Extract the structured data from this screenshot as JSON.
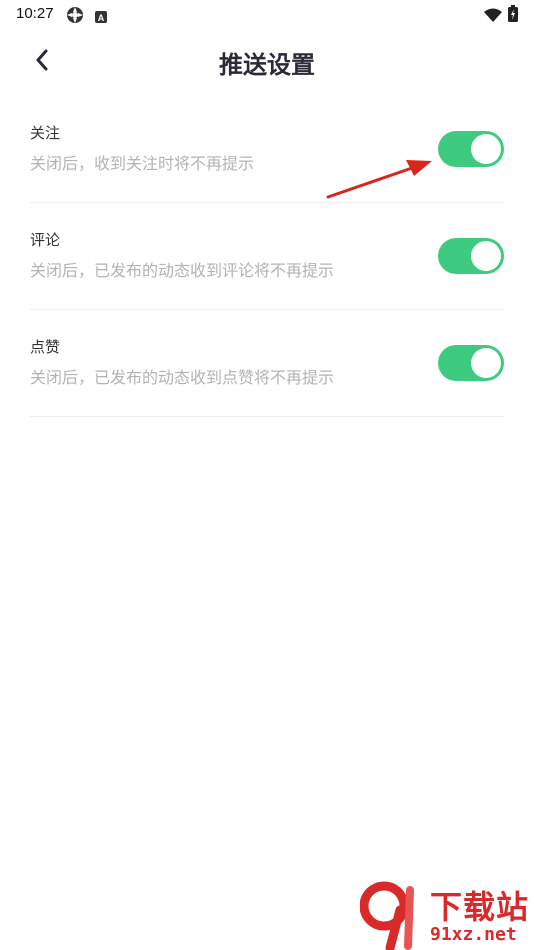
{
  "status_bar": {
    "time": "10:27"
  },
  "header": {
    "title": "推送设置"
  },
  "settings": [
    {
      "title": "关注",
      "description": "关闭后，收到关注时将不再提示",
      "enabled": true
    },
    {
      "title": "评论",
      "description": "关闭后，已发布的动态收到评论将不再提示",
      "enabled": true
    },
    {
      "title": "点赞",
      "description": "关闭后，已发布的动态收到点赞将不再提示",
      "enabled": true
    }
  ],
  "watermark": {
    "text": "下载站",
    "url": "91xz.net"
  },
  "colors": {
    "toggle_on": "#3ecb7f",
    "annotation_arrow": "#d9261c",
    "watermark": "#d92a2a"
  }
}
